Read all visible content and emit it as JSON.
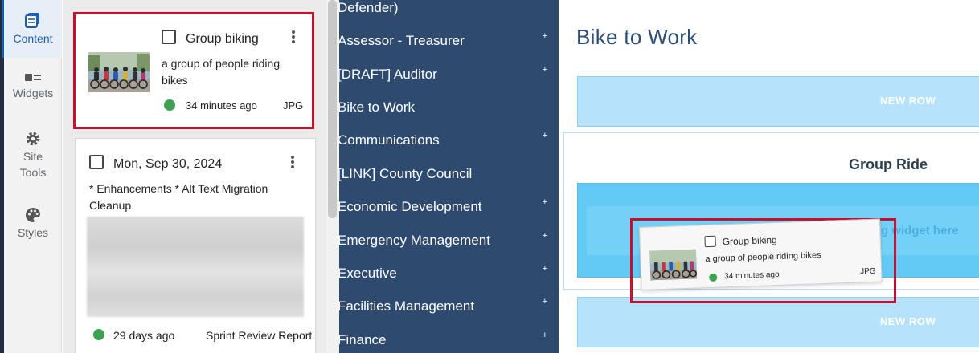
{
  "rail": {
    "items": [
      {
        "label": "Content"
      },
      {
        "label": "Widgets"
      },
      {
        "label": "Site Tools"
      },
      {
        "label": "Styles"
      }
    ]
  },
  "content_panel": {
    "cards": [
      {
        "title": "Group biking",
        "description": "a group of people riding bikes",
        "time": "34 minutes ago",
        "type": "JPG",
        "status_color": "#3ea055"
      },
      {
        "title": "Mon, Sep 30, 2024",
        "description": "* Enhancements * Alt Text Migration Cleanup",
        "time": "29 days ago",
        "type": "Sprint Review Report",
        "status_color": "#3ea055"
      }
    ]
  },
  "nav": {
    "items": [
      {
        "label": "Defender)",
        "expandable": false
      },
      {
        "label": "Assessor - Treasurer",
        "expandable": true
      },
      {
        "label": "[DRAFT] Auditor",
        "expandable": true
      },
      {
        "label": "Bike to Work",
        "expandable": false
      },
      {
        "label": "Communications",
        "expandable": true
      },
      {
        "label": "[LINK] County Council",
        "expandable": false
      },
      {
        "label": "Economic Development",
        "expandable": true
      },
      {
        "label": "Emergency Management",
        "expandable": true
      },
      {
        "label": "Executive",
        "expandable": true
      },
      {
        "label": "Facilities Management",
        "expandable": true
      },
      {
        "label": "Finance",
        "expandable": true
      }
    ],
    "plus_glyph": "+"
  },
  "editor": {
    "page_title": "Bike to Work",
    "new_row_label": "NEW ROW",
    "section_title": "Group Ride",
    "drop_hint": "Drag widget here",
    "dragging_card": {
      "title": "Group biking",
      "description": "a group of people riding bikes",
      "time": "34 minutes ago",
      "type": "JPG"
    }
  },
  "colors": {
    "nav_bg": "#2e4a6e",
    "accent": "#1a5fb4",
    "highlight": "#c8102e",
    "row_bg": "#b6e2fb",
    "drop_bg": "#63c9f5"
  }
}
